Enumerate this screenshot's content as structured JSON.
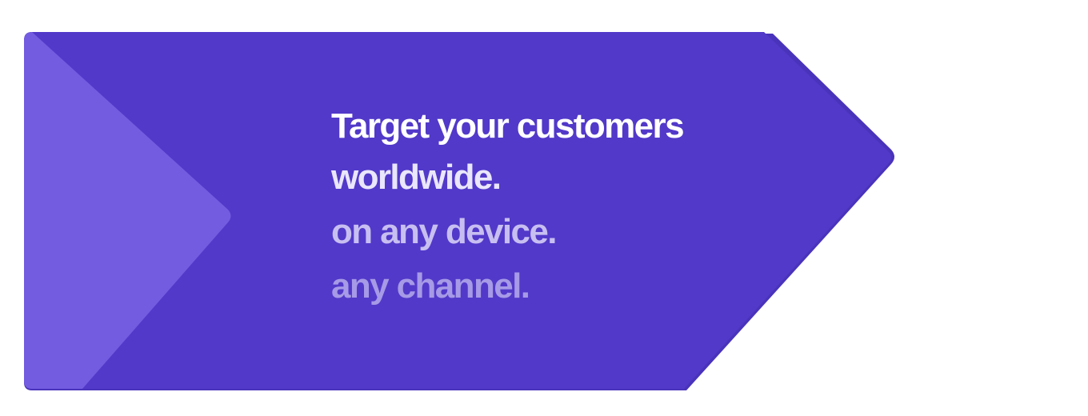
{
  "banner": {
    "headline": {
      "line1": "Target your customers",
      "line2": "worldwide.",
      "line3": "on any device.",
      "line4": "any channel."
    },
    "colors": {
      "background": "#ffffff",
      "arrow_main": "#5239c9",
      "arrow_shadow": "#4a33bb",
      "chevron_light": "#735ce0",
      "text_primary": "#ffffff",
      "text_secondary": "#eae6fb",
      "text_tertiary": "#c8bff1",
      "text_quaternary": "#a79ae6"
    }
  }
}
